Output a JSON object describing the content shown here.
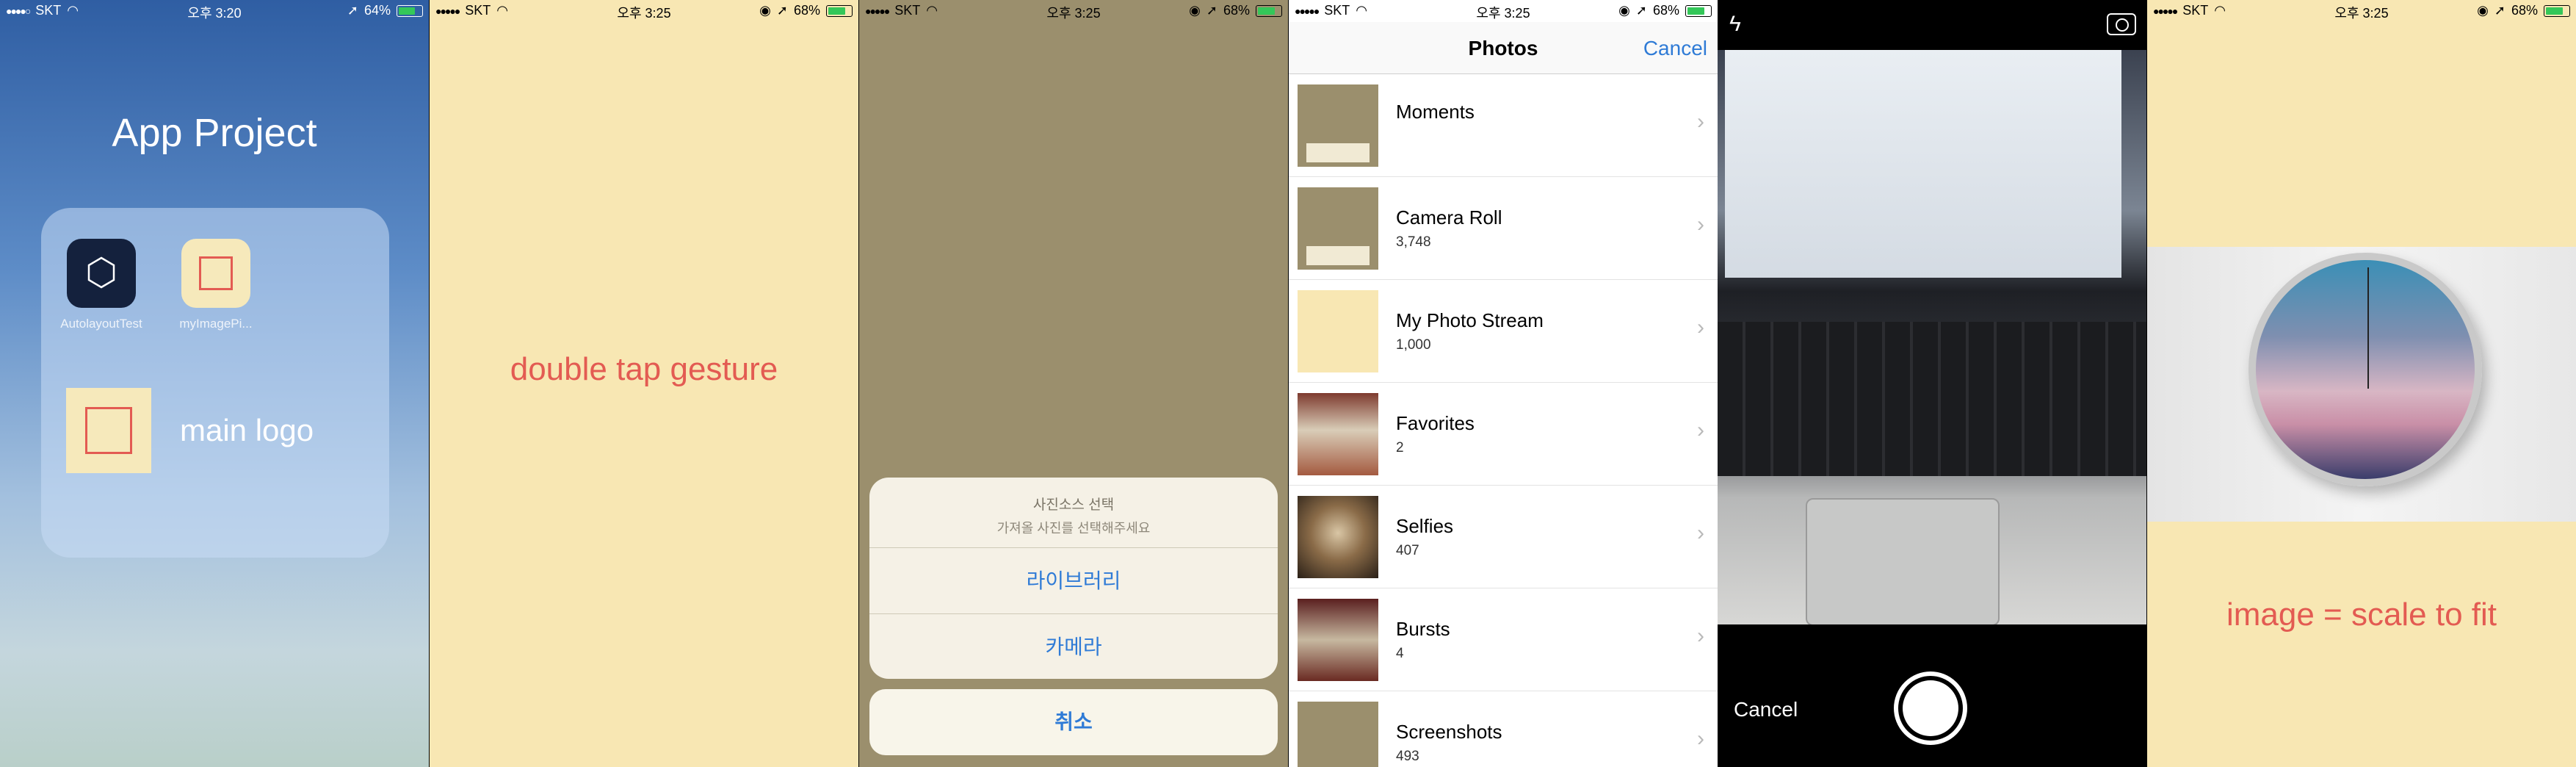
{
  "statusbars": [
    {
      "carrier": "SKT",
      "time": "오후 3:20",
      "battery": "64%"
    },
    {
      "carrier": "SKT",
      "time": "오후 3:25",
      "battery": "68%"
    },
    {
      "carrier": "SKT",
      "time": "오후 3:25",
      "battery": "68%"
    },
    {
      "carrier": "SKT",
      "time": "오후 3:25",
      "battery": "68%"
    },
    {
      "carrier": "SKT",
      "time": "오후 3:25",
      "battery": "68%"
    }
  ],
  "panel1": {
    "folder_title": "App Project",
    "apps": [
      {
        "label": "AutolayoutTest"
      },
      {
        "label": "myImagePi..."
      }
    ],
    "main_logo_label": "main logo"
  },
  "panel2": {
    "caption": "double tap gesture"
  },
  "panel3": {
    "sheet_title": "사진소스 선택",
    "sheet_message": "가져올 사진를 선택해주세요",
    "options": [
      "라이브러리",
      "카메라"
    ],
    "cancel": "취소"
  },
  "panel4": {
    "nav_title": "Photos",
    "cancel": "Cancel",
    "albums": [
      {
        "name": "Moments",
        "count": ""
      },
      {
        "name": "Camera Roll",
        "count": "3,748"
      },
      {
        "name": "My Photo Stream",
        "count": "1,000"
      },
      {
        "name": "Favorites",
        "count": "2"
      },
      {
        "name": "Selfies",
        "count": "407"
      },
      {
        "name": "Bursts",
        "count": "4"
      },
      {
        "name": "Screenshots",
        "count": "493"
      }
    ]
  },
  "panel5": {
    "cancel": "Cancel"
  },
  "panel6": {
    "caption": "image = scale to fit"
  },
  "colors": {
    "accent_red": "#e35b52",
    "ios_blue": "#2f7bd6",
    "cream": "#f8e7b3",
    "khaki": "#9b8f6d"
  }
}
